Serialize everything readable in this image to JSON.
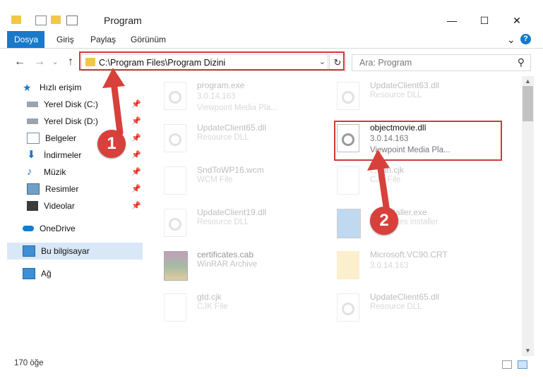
{
  "window": {
    "title": "Program",
    "minimize_glyph": "—",
    "maximize_glyph": "☐",
    "close_glyph": "✕"
  },
  "ribbon": {
    "tabs": [
      "Dosya",
      "Giriş",
      "Paylaş",
      "Görünüm"
    ],
    "expand_glyph": "⌄",
    "help_glyph": "?"
  },
  "nav": {
    "back_glyph": "←",
    "forward_glyph": "→",
    "recent_glyph": "⌄",
    "up_glyph": "↑",
    "address": "C:\\Program Files\\Program Dizini",
    "refresh_glyph": "↻",
    "search_placeholder": "Ara: Program",
    "search_glyph": "⚲"
  },
  "navpane": {
    "quick_access": "Hızlı erişim",
    "items": [
      {
        "label": "Yerel Disk (C:)",
        "icon": "drive-icon",
        "pinned": true
      },
      {
        "label": "Yerel Disk (D:)",
        "icon": "drive-icon",
        "pinned": true
      },
      {
        "label": "Belgeler",
        "icon": "documents-icon",
        "pinned": true
      },
      {
        "label": "İndirmeler",
        "icon": "downloads-icon",
        "pinned": true
      },
      {
        "label": "Müzik",
        "icon": "music-icon",
        "pinned": true
      },
      {
        "label": "Resimler",
        "icon": "pictures-icon",
        "pinned": true
      },
      {
        "label": "Videolar",
        "icon": "videos-icon",
        "pinned": true
      }
    ],
    "onedrive": "OneDrive",
    "this_pc": "Bu bilgisayar",
    "network": "Ağ",
    "pin_glyph": "📌"
  },
  "files": [
    {
      "name": "program.exe",
      "version": "3.0.14.163",
      "type": "Viewpoint Media Pla...",
      "icon": "exe-icon",
      "faded": true
    },
    {
      "name": "UpdateClient63.dll",
      "version": "",
      "type": "Resource DLL",
      "icon": "dll-icon",
      "faded": true
    },
    {
      "name": "UpdateClient65.dll",
      "version": "",
      "type": "Resource DLL",
      "icon": "dll-icon",
      "faded": true
    },
    {
      "name": "objectmovie.dll",
      "version": "3.0.14.163",
      "type": "Viewpoint Media Pla...",
      "icon": "dll-icon",
      "faded": false
    },
    {
      "name": "SndToWP16.wcm",
      "version": "",
      "type": "WCM File",
      "icon": "file-icon",
      "faded": true
    },
    {
      "name": "...ean.cjk",
      "version": "",
      "type": "CJK File",
      "icon": "file-icon",
      "faded": true
    },
    {
      "name": "UpdateClient19.dll",
      "version": "",
      "type": "Resource DLL",
      "icon": "dll-icon",
      "faded": true
    },
    {
      "name": "...eInstaller.exe",
      "version": "",
      "type": "... updates installer",
      "icon": "installer-icon",
      "faded": true
    },
    {
      "name": "certificates.cab",
      "version": "",
      "type": "WinRAR Archive",
      "icon": "archive-icon",
      "faded": true
    },
    {
      "name": "Microsoft.VC90.CRT",
      "version": "3.0.14.163",
      "type": "",
      "icon": "folder-icon",
      "faded": true
    },
    {
      "name": "gtd.cjk",
      "version": "",
      "type": "CJK File",
      "icon": "file-icon",
      "faded": true
    },
    {
      "name": "UpdateClient65.dll",
      "version": "",
      "type": "Resource DLL",
      "icon": "dll-icon",
      "faded": true
    }
  ],
  "status": {
    "count": "170 öğe"
  },
  "annotations": {
    "step1": "1",
    "step2": "2",
    "accent": "#d03a3a"
  }
}
